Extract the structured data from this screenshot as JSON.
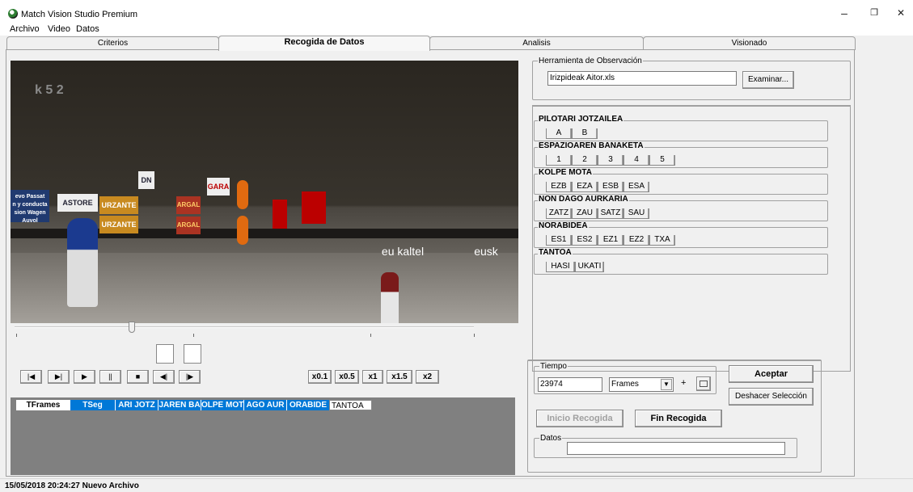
{
  "window": {
    "title": "Match Vision Studio Premium",
    "min": "–",
    "restore": "❐",
    "close": "✕"
  },
  "menu": [
    "Archivo",
    "Video",
    "Datos"
  ],
  "tabs": [
    "Criterios",
    "Recogida de Datos",
    "Analisis",
    "Visionado"
  ],
  "video_overlay": {
    "score": "k 5 2",
    "ad_left1": "evo Passat",
    "ad_left2": "n y conducta",
    "ad_left3": "sion Wagen",
    "ad_left4": "Auvol",
    "sign_astore": "ASTORE",
    "sign_urzante": "URZANTE",
    "sign_dn": "DN",
    "sign_gara": "GARA",
    "sign_argal": "ARGAL",
    "sign_euskaltel": "eu kaltel",
    "sign_eusk": "eusk"
  },
  "playback": {
    "buttons": [
      "|◀",
      "▶|",
      "▶",
      "||",
      "■",
      "◀|",
      "|▶"
    ],
    "speeds": [
      "x0.1",
      "x0.5",
      "x1",
      "x1.5",
      "x2"
    ]
  },
  "grid_columns": [
    "TFrames",
    "TSeg",
    "ARI JOTZ",
    "JAREN BA",
    "OLPE MOT",
    "AGO AUR",
    "ORABIDE",
    "TANTOA"
  ],
  "tool": {
    "legend": "Herramienta de Observación",
    "file": "Irizpideak Aitor.xls",
    "browse": "Examinar..."
  },
  "criteria": [
    {
      "title": "PILOTARI JOTZAILEA",
      "options": [
        "A",
        "B"
      ]
    },
    {
      "title": "ESPAZIOAREN BANAKETA",
      "options": [
        "1",
        "2",
        "3",
        "4",
        "5"
      ]
    },
    {
      "title": "KOLPE MOTA",
      "options": [
        "EZB",
        "EZA",
        "ESB",
        "ESA"
      ]
    },
    {
      "title": "NON DAGO AURKARIA",
      "options": [
        "ZATZ",
        "ZAU",
        "SATZ",
        "SAU"
      ]
    },
    {
      "title": "NORABIDEA",
      "options": [
        "ES1",
        "ES2",
        "EZ1",
        "EZ2",
        "TXA"
      ]
    },
    {
      "title": "TANTOA",
      "options": [
        "HASI",
        "UKATI"
      ]
    }
  ],
  "time": {
    "legend": "Tiempo",
    "value": "23974",
    "unit": "Frames",
    "plus": "+",
    "accept": "Aceptar",
    "undo": "Deshacer Selección",
    "start": "Inicio Recogida",
    "end": "Fin Recogida",
    "data_legend": "Datos",
    "data_value": ""
  },
  "status": "15/05/2018   20:24:27   Nuevo Archivo",
  "colors": {
    "header_blue": "#0078d7",
    "header_white": "#ffffff",
    "grid_gray": "#808080"
  }
}
